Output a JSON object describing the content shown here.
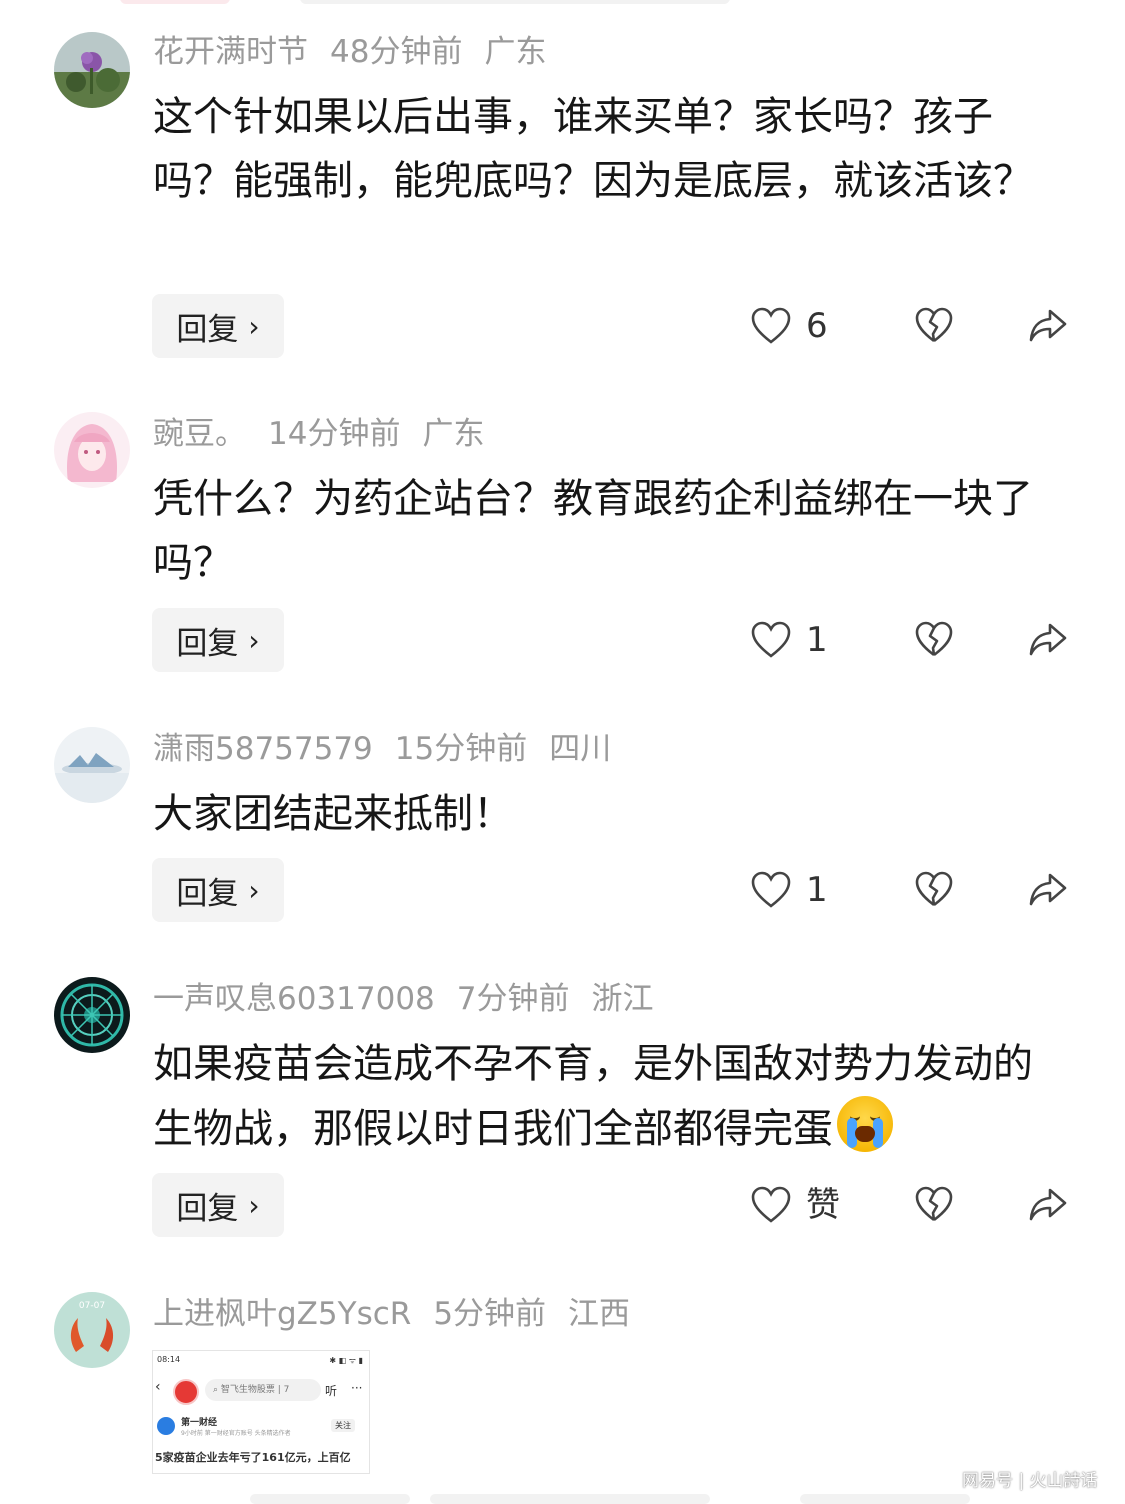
{
  "comments": [
    {
      "username": "花开满时节",
      "time": "48分钟前",
      "location": "广东",
      "text": "这个针如果以后出事，谁来买单？家长吗？孩子吗？能强制，能兜底吗？因为是底层，就该活该？",
      "reply_label": "回复",
      "like_count": "6",
      "avatar_icon": "flower-photo-avatar"
    },
    {
      "username": "豌豆。",
      "time": "14分钟前",
      "location": "广东",
      "text": "凭什么？为药企站台？教育跟药企利益绑在一块了吗？",
      "reply_label": "回复",
      "like_count": "1",
      "avatar_icon": "anime-girl-avatar"
    },
    {
      "username": "潇雨58757579",
      "time": "15分钟前",
      "location": "四川",
      "text": "大家团结起来抵制！",
      "reply_label": "回复",
      "like_count": "1",
      "avatar_icon": "misty-landscape-avatar"
    },
    {
      "username": "一声叹息60317008",
      "time": "7分钟前",
      "location": "浙江",
      "text": "如果疫苗会造成不孕不育，是外国敌对势力发动的生物战，那假以时日我们全部都得完蛋",
      "emoji": "loudly-crying-face-emoji",
      "reply_label": "回复",
      "like_count": "赞",
      "avatar_icon": "teal-mandala-avatar"
    },
    {
      "username": "上进枫叶gZ5YscR",
      "time": "5分钟前",
      "location": "江西",
      "avatar_icon": "koi-fish-avatar",
      "avatar_text": "财神偏爱",
      "avatar_date": "07-07",
      "image": {
        "status_time": "08:14",
        "search_text": "智飞生物股票 | 7",
        "listen": "听",
        "source_name": "第一财经",
        "source_sub": "9小时前  第一财经官方账号 头条精选作者",
        "follow": "关注",
        "headline": "5家疫苗企业去年亏了161亿元，上百亿"
      }
    }
  ],
  "watermark": "网易号 | 火山詩话",
  "colors": {
    "meta_gray": "#9a9a9a",
    "text": "#161616",
    "reply_bg": "#f3f3f3"
  }
}
